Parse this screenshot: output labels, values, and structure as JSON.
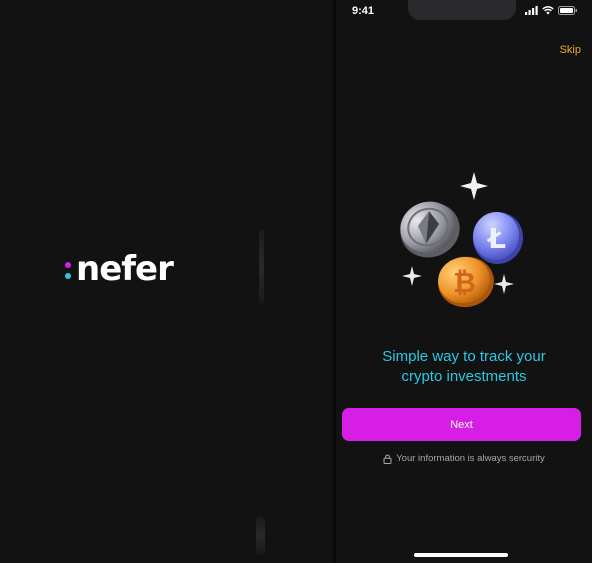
{
  "splash": {
    "logo_text": "nefer",
    "logo_dot_top_color": "#d61ee6",
    "logo_dot_bottom_color": "#29c8e8"
  },
  "onboarding": {
    "status_bar": {
      "time": "9:41",
      "icons": [
        "signal-icon",
        "wifi-icon",
        "battery-icon"
      ]
    },
    "skip_label": "Skip",
    "illustration_icons": [
      "ethereum-coin-icon",
      "litecoin-coin-icon",
      "bitcoin-coin-icon",
      "sparkle-icon"
    ],
    "headline_line1": "Simple way to track your",
    "headline_line2": "crypto investments",
    "next_label": "Next",
    "security_note": "Your information is always sercurity"
  },
  "colors": {
    "accent_magenta": "#d61ee6",
    "accent_cyan": "#29c8e8",
    "skip_orange": "#f5a623",
    "background": "#121212"
  }
}
